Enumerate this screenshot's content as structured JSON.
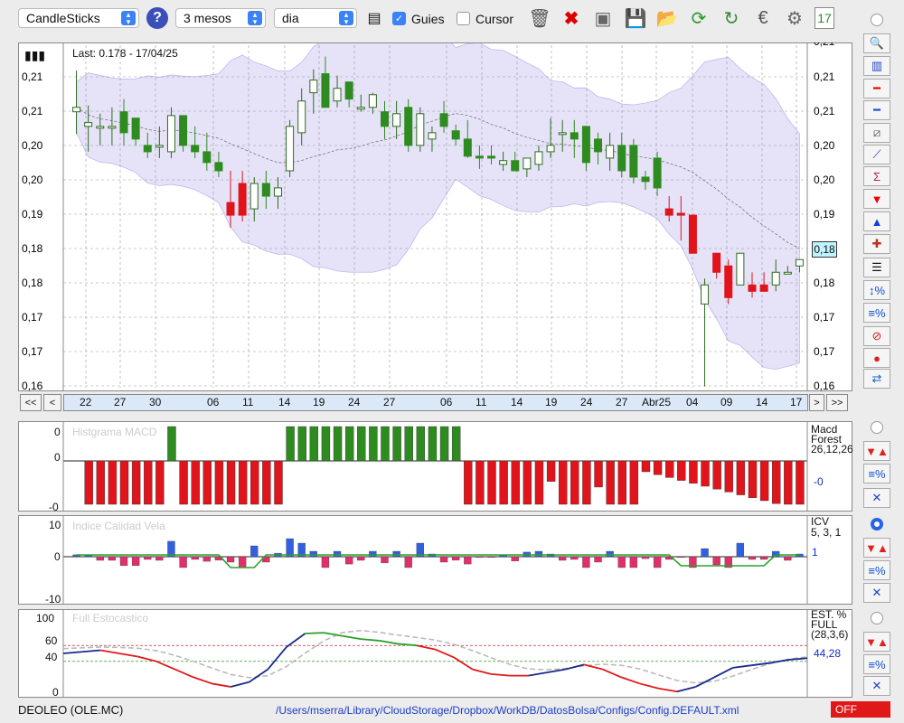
{
  "toolbar": {
    "chart_type": "CandleSticks",
    "period": "3 mesos",
    "interval": "dia",
    "guides_label": "Guies",
    "guides_checked": true,
    "cursor_label": "Cursor",
    "cursor_checked": false,
    "icons": [
      "trash-icon",
      "delete-x-icon",
      "camera-icon",
      "save-icon",
      "folder-icon",
      "refresh-icon",
      "sync-icon",
      "euro-icon",
      "gear-icon",
      "calendar-icon"
    ]
  },
  "main_chart": {
    "last_label": "Last: 0.178 - 17/04/25",
    "y_labels": [
      "0,21",
      "0,21",
      "0,20",
      "0,20",
      "0,19",
      "0,18",
      "0,18",
      "0,17",
      "0,17",
      "0,16",
      "0,16"
    ],
    "y_labels_top": "0,21",
    "current_value": "0,18",
    "x_labels": [
      "22",
      "27",
      "30",
      "06",
      "11",
      "14",
      "19",
      "24",
      "27",
      "06",
      "11",
      "14",
      "19",
      "24",
      "27",
      "Abr25",
      "04",
      "09",
      "14",
      "17"
    ],
    "nav": {
      "first": "<<",
      "prev": "<",
      "next": ">",
      "last": ">>"
    }
  },
  "chart_data": {
    "type": "candlestick",
    "ylim": [
      0.158,
      0.212
    ],
    "candles": [
      {
        "o": 0.2015,
        "h": 0.208,
        "l": 0.198,
        "c": 0.2022
      },
      {
        "o": 0.1992,
        "h": 0.2025,
        "l": 0.1952,
        "c": 0.1998
      },
      {
        "o": 0.1992,
        "h": 0.2012,
        "l": 0.1962,
        "c": 0.1992
      },
      {
        "o": 0.1992,
        "h": 0.2022,
        "l": 0.1962,
        "c": 0.1992
      },
      {
        "o": 0.2015,
        "h": 0.2035,
        "l": 0.1962,
        "c": 0.1982
      },
      {
        "o": 0.2005,
        "h": 0.2005,
        "l": 0.1962,
        "c": 0.1972
      },
      {
        "o": 0.1962,
        "h": 0.1982,
        "l": 0.1942,
        "c": 0.1952
      },
      {
        "o": 0.1962,
        "h": 0.1992,
        "l": 0.1942,
        "c": 0.1962
      },
      {
        "o": 0.1952,
        "h": 0.2022,
        "l": 0.1942,
        "c": 0.2009
      },
      {
        "o": 0.2009,
        "h": 0.2009,
        "l": 0.1952,
        "c": 0.1962
      },
      {
        "o": 0.1962,
        "h": 0.1992,
        "l": 0.1942,
        "c": 0.1952
      },
      {
        "o": 0.1952,
        "h": 0.1982,
        "l": 0.1922,
        "c": 0.1935
      },
      {
        "o": 0.1935,
        "h": 0.1952,
        "l": 0.1912,
        "c": 0.1922
      },
      {
        "o": 0.1872,
        "h": 0.1922,
        "l": 0.1832,
        "c": 0.1852
      },
      {
        "o": 0.1902,
        "h": 0.1922,
        "l": 0.1842,
        "c": 0.1852
      },
      {
        "o": 0.1862,
        "h": 0.1912,
        "l": 0.1842,
        "c": 0.1902
      },
      {
        "o": 0.1902,
        "h": 0.1922,
        "l": 0.1862,
        "c": 0.1882
      },
      {
        "o": 0.1882,
        "h": 0.1912,
        "l": 0.1862,
        "c": 0.1895
      },
      {
        "o": 0.1922,
        "h": 0.2002,
        "l": 0.1912,
        "c": 0.1992
      },
      {
        "o": 0.1982,
        "h": 0.2052,
        "l": 0.1962,
        "c": 0.2032
      },
      {
        "o": 0.2045,
        "h": 0.2082,
        "l": 0.2012,
        "c": 0.2065
      },
      {
        "o": 0.2075,
        "h": 0.2102,
        "l": 0.2042,
        "c": 0.2022
      },
      {
        "o": 0.2032,
        "h": 0.2072,
        "l": 0.2022,
        "c": 0.2052
      },
      {
        "o": 0.2062,
        "h": 0.2062,
        "l": 0.2022,
        "c": 0.2035
      },
      {
        "o": 0.2022,
        "h": 0.2042,
        "l": 0.2015,
        "c": 0.2022
      },
      {
        "o": 0.2022,
        "h": 0.2045,
        "l": 0.2012,
        "c": 0.2042
      },
      {
        "o": 0.2015,
        "h": 0.2032,
        "l": 0.1972,
        "c": 0.1992
      },
      {
        "o": 0.1992,
        "h": 0.2032,
        "l": 0.1972,
        "c": 0.2012
      },
      {
        "o": 0.2022,
        "h": 0.2035,
        "l": 0.1952,
        "c": 0.1962
      },
      {
        "o": 0.1962,
        "h": 0.2022,
        "l": 0.1952,
        "c": 0.2012
      },
      {
        "o": 0.1972,
        "h": 0.1992,
        "l": 0.1952,
        "c": 0.1982
      },
      {
        "o": 0.2012,
        "h": 0.2032,
        "l": 0.1982,
        "c": 0.1992
      },
      {
        "o": 0.1985,
        "h": 0.1995,
        "l": 0.1962,
        "c": 0.1972
      },
      {
        "o": 0.1972,
        "h": 0.2002,
        "l": 0.1942,
        "c": 0.1945
      },
      {
        "o": 0.1945,
        "h": 0.1962,
        "l": 0.1925,
        "c": 0.1942
      },
      {
        "o": 0.1945,
        "h": 0.1962,
        "l": 0.1932,
        "c": 0.1942
      },
      {
        "o": 0.1932,
        "h": 0.1952,
        "l": 0.1922,
        "c": 0.1938
      },
      {
        "o": 0.1938,
        "h": 0.1952,
        "l": 0.1922,
        "c": 0.1922
      },
      {
        "o": 0.1925,
        "h": 0.1942,
        "l": 0.1912,
        "c": 0.1942
      },
      {
        "o": 0.1932,
        "h": 0.1962,
        "l": 0.1922,
        "c": 0.1952
      },
      {
        "o": 0.1952,
        "h": 0.2005,
        "l": 0.1942,
        "c": 0.1962
      },
      {
        "o": 0.1982,
        "h": 0.2002,
        "l": 0.1952,
        "c": 0.1982
      },
      {
        "o": 0.1982,
        "h": 0.2002,
        "l": 0.1942,
        "c": 0.1972
      },
      {
        "o": 0.1992,
        "h": 0.1992,
        "l": 0.1922,
        "c": 0.1935
      },
      {
        "o": 0.1972,
        "h": 0.1982,
        "l": 0.1932,
        "c": 0.1952
      },
      {
        "o": 0.1942,
        "h": 0.1982,
        "l": 0.1922,
        "c": 0.1962
      },
      {
        "o": 0.1962,
        "h": 0.1982,
        "l": 0.1912,
        "c": 0.1922
      },
      {
        "o": 0.1962,
        "h": 0.1972,
        "l": 0.1902,
        "c": 0.1912
      },
      {
        "o": 0.1912,
        "h": 0.1922,
        "l": 0.1892,
        "c": 0.1905
      },
      {
        "o": 0.1942,
        "h": 0.1952,
        "l": 0.1882,
        "c": 0.1895
      },
      {
        "o": 0.1862,
        "h": 0.1882,
        "l": 0.1842,
        "c": 0.1852
      },
      {
        "o": 0.1855,
        "h": 0.1882,
        "l": 0.1812,
        "c": 0.1852
      },
      {
        "o": 0.1852,
        "h": 0.1852,
        "l": 0.1792,
        "c": 0.1792
      },
      {
        "o": 0.1712,
        "h": 0.1752,
        "l": 0.1582,
        "c": 0.1742
      },
      {
        "o": 0.1792,
        "h": 0.1792,
        "l": 0.1752,
        "c": 0.1762
      },
      {
        "o": 0.1772,
        "h": 0.1782,
        "l": 0.1712,
        "c": 0.1722
      },
      {
        "o": 0.1742,
        "h": 0.1792,
        "l": 0.1742,
        "c": 0.1792
      },
      {
        "o": 0.1742,
        "h": 0.1762,
        "l": 0.1722,
        "c": 0.1732
      },
      {
        "o": 0.1742,
        "h": 0.1762,
        "l": 0.1732,
        "c": 0.1732
      },
      {
        "o": 0.1742,
        "h": 0.1782,
        "l": 0.1732,
        "c": 0.1762
      },
      {
        "o": 0.1762,
        "h": 0.1772,
        "l": 0.1762,
        "c": 0.1762
      },
      {
        "o": 0.1772,
        "h": 0.1782,
        "l": 0.1762,
        "c": 0.1782
      }
    ]
  },
  "macd": {
    "label": "Histgrama MACD",
    "right_title": [
      "Macd",
      "Forest",
      "26,12,26"
    ],
    "value": "-0",
    "y_labels": [
      "0",
      "0",
      "-0"
    ]
  },
  "icv": {
    "label": "Indice Calidad Vela",
    "right_title": [
      "ICV",
      "5, 3, 1"
    ],
    "value": "1",
    "y_labels": [
      "10",
      "0",
      "-10"
    ]
  },
  "stoch": {
    "label": "Full Estocastico",
    "right_title": [
      "EST. %",
      "FULL",
      "(28,3,6)"
    ],
    "value": "44,28",
    "y_labels": [
      "100",
      "60",
      "40",
      "0"
    ]
  },
  "status": {
    "ticker": "DEOLEO (OLE.MC)",
    "path": "/Users/mserra/Library/CloudStorage/Dropbox/WorkDB/DatosBolsa/Configs/Config.DEFAULT.xml",
    "off": "OFF"
  },
  "colors": {
    "up": "#2e8b1f",
    "down": "#e0141a",
    "band": "#8f7fe0",
    "macd_up": "#2e8b1f",
    "macd_down": "#e0141a",
    "icv_up": "#3060e0",
    "icv_down": "#e0306a"
  }
}
